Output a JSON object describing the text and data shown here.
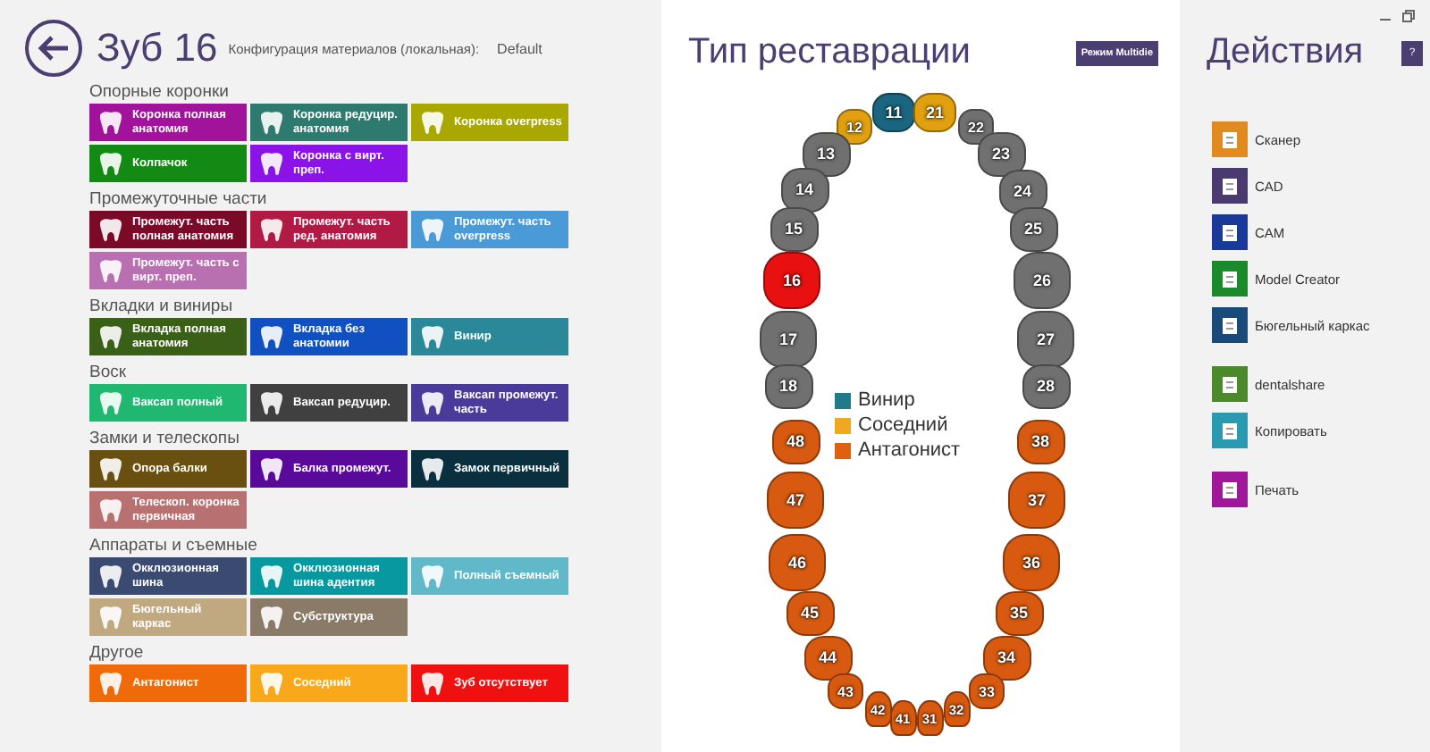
{
  "header": {
    "title": "Зуб 16",
    "config_label": "Конфигурация материалов (локальная):",
    "config_value": "Default"
  },
  "sections": [
    {
      "title": "Опорные коронки",
      "buttons": [
        {
          "label": "Коронка полная анатомия",
          "color": "#a0139a"
        },
        {
          "label": "Коронка редуцир. анатомия",
          "color": "#2e7a6e"
        },
        {
          "label": "Коронка overpress",
          "color": "#a8a800"
        },
        {
          "label": "Колпачок",
          "color": "#138a13"
        },
        {
          "label": "Коронка с вирт. преп.",
          "color": "#8a14e8"
        }
      ]
    },
    {
      "title": "Промежуточные части",
      "buttons": [
        {
          "label": "Промежут. часть полная анатомия",
          "color": "#7a0a28"
        },
        {
          "label": "Промежут. часть ред. анатомия",
          "color": "#b01a44"
        },
        {
          "label": "Промежут. часть overpress",
          "color": "#4a9ad8"
        },
        {
          "label": "Промежут. часть с вирт. преп.",
          "color": "#b870b0"
        }
      ]
    },
    {
      "title": "Вкладки и виниры",
      "buttons": [
        {
          "label": "Вкладка полная анатомия",
          "color": "#3a6018"
        },
        {
          "label": "Вкладка без анатомии",
          "color": "#1050c0"
        },
        {
          "label": "Винир",
          "color": "#2a8898"
        }
      ]
    },
    {
      "title": "Воск",
      "buttons": [
        {
          "label": "Ваксап полный",
          "color": "#20b870"
        },
        {
          "label": "Ваксап редуцир.",
          "color": "#404040"
        },
        {
          "label": "Ваксап промежут. часть",
          "color": "#4a3a9a"
        }
      ]
    },
    {
      "title": "Замки и телескопы",
      "buttons": [
        {
          "label": "Опора балки",
          "color": "#6a5010"
        },
        {
          "label": "Балка промежут.",
          "color": "#5a0a9a"
        },
        {
          "label": "Замок первичный",
          "color": "#0a3040"
        },
        {
          "label": "Телескоп. коронка первичная",
          "color": "#b87070"
        }
      ]
    },
    {
      "title": "Аппараты и съемные",
      "buttons": [
        {
          "label": "Окклюзионная шина",
          "color": "#3a4a70"
        },
        {
          "label": "Окклюзионная шина адентия",
          "color": "#0898a0"
        },
        {
          "label": "Полный съемный",
          "color": "#60b8c8"
        },
        {
          "label": "Бюгельный каркас",
          "color": "#c0a880"
        },
        {
          "label": "Субструктура",
          "color": "#8a7a68"
        }
      ]
    },
    {
      "title": "Другое",
      "buttons": [
        {
          "label": "Антагонист",
          "color": "#f06a0a"
        },
        {
          "label": "Соседний",
          "color": "#f8a818"
        },
        {
          "label": "Зуб отсутствует",
          "color": "#f01010"
        }
      ]
    }
  ],
  "restoration": {
    "title": "Тип реставрации",
    "mode_button": "Режим Multidie",
    "teeth": [
      {
        "number": "11",
        "kind": "incisor",
        "color": "#1a6680"
      },
      {
        "number": "21",
        "kind": "incisor",
        "color": "#e0a010"
      },
      {
        "number": "12",
        "kind": "small",
        "color": "#e0a010"
      },
      {
        "number": "22",
        "kind": "small",
        "color": "#707070"
      },
      {
        "number": "13",
        "kind": "premolar",
        "color": "#707070"
      },
      {
        "number": "23",
        "kind": "premolar",
        "color": "#707070"
      },
      {
        "number": "14",
        "kind": "premolar",
        "color": "#707070"
      },
      {
        "number": "24",
        "kind": "premolar",
        "color": "#707070"
      },
      {
        "number": "15",
        "kind": "premolar",
        "color": "#707070"
      },
      {
        "number": "25",
        "kind": "premolar",
        "color": "#707070"
      },
      {
        "number": "16",
        "kind": "molar",
        "color": "#e81010"
      },
      {
        "number": "26",
        "kind": "molar",
        "color": "#707070"
      },
      {
        "number": "17",
        "kind": "molar",
        "color": "#707070"
      },
      {
        "number": "27",
        "kind": "molar",
        "color": "#707070"
      },
      {
        "number": "18",
        "kind": "premolar",
        "color": "#707070"
      },
      {
        "number": "28",
        "kind": "premolar",
        "color": "#707070"
      },
      {
        "number": "48",
        "kind": "premolar",
        "color": "#d85a10"
      },
      {
        "number": "38",
        "kind": "premolar",
        "color": "#d85a10"
      },
      {
        "number": "47",
        "kind": "molar",
        "color": "#d85a10"
      },
      {
        "number": "37",
        "kind": "molar",
        "color": "#d85a10"
      },
      {
        "number": "46",
        "kind": "molar",
        "color": "#d85a10"
      },
      {
        "number": "36",
        "kind": "molar",
        "color": "#d85a10"
      },
      {
        "number": "45",
        "kind": "premolar",
        "color": "#d85a10"
      },
      {
        "number": "35",
        "kind": "premolar",
        "color": "#d85a10"
      },
      {
        "number": "44",
        "kind": "premolar",
        "color": "#d85a10"
      },
      {
        "number": "34",
        "kind": "premolar",
        "color": "#d85a10"
      },
      {
        "number": "43",
        "kind": "small",
        "color": "#d85a10"
      },
      {
        "number": "33",
        "kind": "small",
        "color": "#d85a10"
      },
      {
        "number": "42",
        "kind": "lower",
        "color": "#d85a10"
      },
      {
        "number": "32",
        "kind": "lower",
        "color": "#d85a10"
      },
      {
        "number": "41",
        "kind": "lower",
        "color": "#d85a10"
      },
      {
        "number": "31",
        "kind": "lower",
        "color": "#d85a10"
      }
    ],
    "legend": [
      {
        "label": "Винир",
        "color": "#1f7a8c"
      },
      {
        "label": "Соседний",
        "color": "#f0a820"
      },
      {
        "label": "Антагонист",
        "color": "#e06010"
      }
    ]
  },
  "actions": {
    "title": "Действия",
    "help_button": "?",
    "groups": [
      [
        {
          "label": "Сканер",
          "color": "#e08a20"
        },
        {
          "label": "CAD",
          "color": "#4a3a70"
        },
        {
          "label": "CAM",
          "color": "#1a3a9a"
        },
        {
          "label": "Model Creator",
          "color": "#1a8a2a"
        },
        {
          "label": "Бюгельный каркас",
          "color": "#1a4a7a"
        }
      ],
      [
        {
          "label": "dentalshare",
          "color": "#4a8a2a"
        },
        {
          "label": "Копировать",
          "color": "#2a9ab0"
        }
      ],
      [
        {
          "label": "Печать",
          "color": "#a0189a"
        }
      ]
    ]
  }
}
